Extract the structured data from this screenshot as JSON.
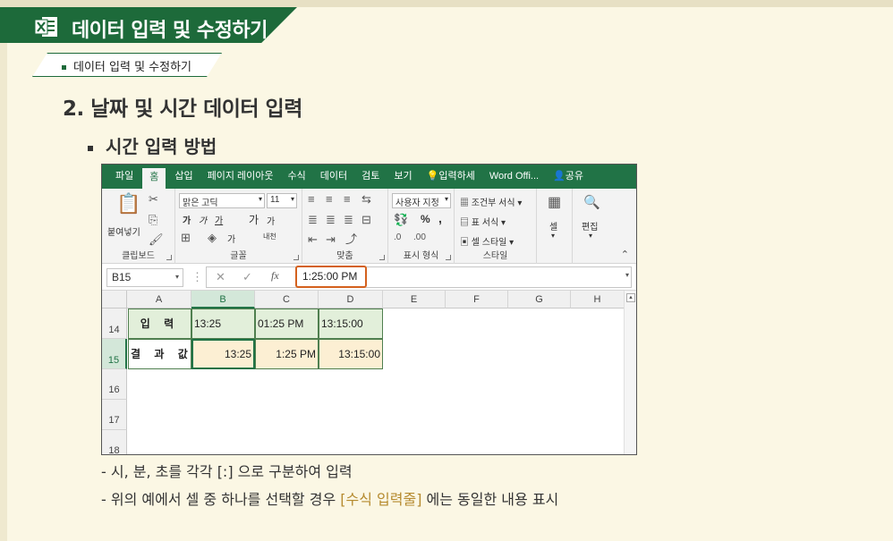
{
  "header": {
    "title": "데이터 입력 및 수정하기",
    "icon": "excel-logo-icon",
    "sub_title": "데이터 입력 및 수정하기"
  },
  "section": {
    "title": "2. 날짜 및 시간 데이터 입력",
    "bullet": "시간 입력 방법"
  },
  "excel": {
    "tabs": [
      "파일",
      "홈",
      "삽입",
      "페이지 레이아웃",
      "수식",
      "데이터",
      "검토",
      "보기",
      "입력하세",
      "Word Offi...",
      "공유"
    ],
    "active_tab": "홈",
    "ribbon": {
      "clipboard": {
        "label": "클립보드",
        "paste": "붙여넣기"
      },
      "font": {
        "label": "글꼴",
        "font_name": "맑은 고딕",
        "font_size": "11",
        "bold": "가",
        "italic": "가",
        "underline": "가",
        "grow": "가",
        "shrink": "가",
        "color": "가",
        "phonetic": "내천"
      },
      "align": {
        "label": "맞춤"
      },
      "number": {
        "label": "표시 형식",
        "format": "사용자 지정",
        "percent": "%",
        "comma": ","
      },
      "styles": {
        "label": "스타일",
        "cond": "조건부 서식",
        "table": "표 서식",
        "cell": "셀 스타일"
      },
      "cells": {
        "label": "셀"
      },
      "edit": {
        "label": "편집"
      }
    },
    "name_box": "B15",
    "formula_value": "1:25:00 PM",
    "columns": [
      "A",
      "B",
      "C",
      "D",
      "E",
      "F",
      "G",
      "H"
    ],
    "rows": [
      "14",
      "15",
      "16",
      "17",
      "18"
    ],
    "row14": {
      "label": "입 력",
      "b": "13:25",
      "c": "01:25 PM",
      "d": "13:15:00"
    },
    "row15": {
      "label": "결 과 값",
      "b": "13:25",
      "c": "1:25 PM",
      "d": "13:15:00"
    }
  },
  "notes": {
    "line1": "- 시, 분, 초를 각각 [:] 으로 구분하여 입력",
    "line2_pre": "- 위의 예에서 셀 중 하나를 선택할 경우 ",
    "line2_hl": "[수식 입력줄]",
    "line2_post": " 에는 동일한 내용 표시"
  },
  "colors": {
    "excel_green": "#217346",
    "header_green": "#1d6a3a",
    "input_fill": "#e2efda",
    "result_fill": "#fcefd3",
    "highlight": "#d4611e"
  }
}
